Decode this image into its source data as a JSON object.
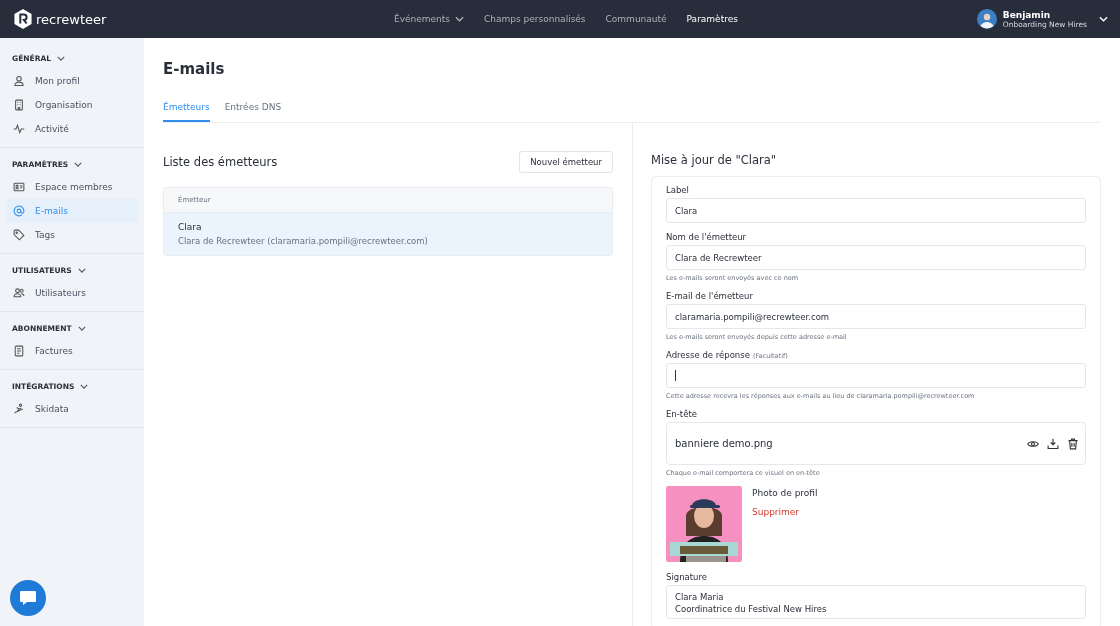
{
  "topbar": {
    "brand": "recrewteer",
    "nav": [
      {
        "label": "Événements",
        "dropdown": true,
        "selected": false
      },
      {
        "label": "Champs personnalisés",
        "dropdown": false,
        "selected": false
      },
      {
        "label": "Communauté",
        "dropdown": false,
        "selected": false
      },
      {
        "label": "Paramètres",
        "dropdown": false,
        "selected": true
      }
    ],
    "user": {
      "name": "Benjamin",
      "organization": "Onboarding New Hires"
    }
  },
  "sidebar": {
    "sections": [
      {
        "title": "GÉNÉRAL",
        "expanded": true,
        "items": [
          {
            "label": "Mon profil",
            "selected": false
          },
          {
            "label": "Organisation",
            "selected": false
          },
          {
            "label": "Activité",
            "selected": false
          }
        ]
      },
      {
        "title": "PARAMÈTRES",
        "expanded": true,
        "items": [
          {
            "label": "Espace membres",
            "selected": false
          },
          {
            "label": "E-mails",
            "selected": true
          },
          {
            "label": "Tags",
            "selected": false
          }
        ]
      },
      {
        "title": "UTILISATEURS",
        "expanded": true,
        "items": [
          {
            "label": "Utilisateurs",
            "selected": false
          }
        ]
      },
      {
        "title": "ABONNEMENT",
        "expanded": true,
        "items": [
          {
            "label": "Factures",
            "selected": false
          }
        ]
      },
      {
        "title": "INTÉGRATIONS",
        "expanded": true,
        "items": [
          {
            "label": "Skidata",
            "selected": false
          }
        ]
      }
    ]
  },
  "page": {
    "title": "E-mails",
    "tabs": [
      {
        "label": "Émetteurs",
        "selected": true
      },
      {
        "label": "Entrées DNS",
        "selected": false
      }
    ]
  },
  "senders": {
    "title": "Liste des émetteurs",
    "new_button": "Nouvel émetteur",
    "column": "Émetteur",
    "rows": [
      {
        "name": "Clara",
        "detail": "Clara de Recrewteer (claramaria.pompili@recrewteer.com)",
        "selected": true
      }
    ]
  },
  "form": {
    "title": "Mise à jour de \"Clara\"",
    "fields": [
      {
        "label": "Label",
        "value": "Clara"
      },
      {
        "label": "Nom de l'émetteur",
        "value": "Clara de Recrewteer",
        "help": "Les e-mails seront envoyés avec ce nom"
      },
      {
        "label": "E-mail de l'émetteur",
        "value": "claramaria.pompili@recrewteer.com",
        "help": "Les e-mails seront envoyés depuis cette adresse e-mail"
      },
      {
        "label": "Adresse de réponse",
        "optional": "(Facultatif)",
        "focused": true,
        "help": "Cette adresse recevra les réponses aux e-mails au lieu de claramaria.pompili@recrewteer.com"
      }
    ],
    "header": {
      "label": "En-tête",
      "file": "banniere demo.png",
      "help": "Chaque e-mail comportera ce visuel en en-tête"
    },
    "photo": {
      "kind": "picture",
      "label": "Photo de profil",
      "remove": "Supprimer"
    },
    "signature": {
      "label": "Signature",
      "lines": [
        "Clara Maria",
        "Coordinatrice du Festival New Hires"
      ]
    }
  }
}
